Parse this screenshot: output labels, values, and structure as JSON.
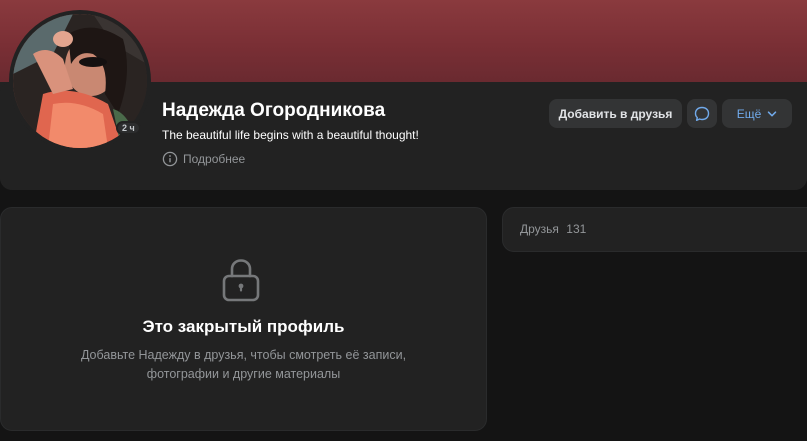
{
  "profile": {
    "name": "Надежда Огородникова",
    "status": "The beautiful life begins with a beautiful thought!",
    "more_info_label": "Подробнее",
    "online_badge": "2 ч"
  },
  "actions": {
    "add_friend_label": "Добавить в друзья",
    "more_label": "Ещё",
    "message_icon": "chat-bubble-icon",
    "more_icon": "chevron-down-icon"
  },
  "locked": {
    "icon": "lock-icon",
    "title": "Это закрытый профиль",
    "description": "Добавьте Надежду в друзья, чтобы смотреть её записи, фотографии и другие материалы"
  },
  "friends": {
    "label": "Друзья",
    "count": "131"
  },
  "colors": {
    "cover": "#7a2f35",
    "card": "#222222",
    "page": "#141414",
    "button": "#333435",
    "accent": "#71aaeb",
    "muted": "#939699"
  }
}
